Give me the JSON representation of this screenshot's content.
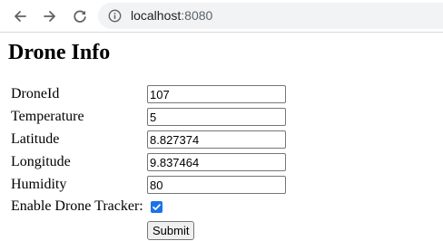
{
  "browser": {
    "url_host": "localhost",
    "url_port": ":8080",
    "icons": [
      "back-arrow-icon",
      "forward-arrow-icon",
      "reload-icon",
      "info-icon"
    ]
  },
  "page": {
    "title": "Drone Info",
    "fields": [
      {
        "label": "DroneId",
        "value": "107"
      },
      {
        "label": "Temperature",
        "value": "5"
      },
      {
        "label": "Latitude",
        "value": "8.827374"
      },
      {
        "label": "Longitude",
        "value": "9.837464"
      },
      {
        "label": "Humidity",
        "value": "80"
      }
    ],
    "tracker_label": "Enable Drone Tracker:",
    "tracker_checked": true,
    "submit_label": "Submit"
  },
  "colors": {
    "checkbox_accent": "#1a73e8",
    "omnibox_bg": "#f1f3f4"
  }
}
